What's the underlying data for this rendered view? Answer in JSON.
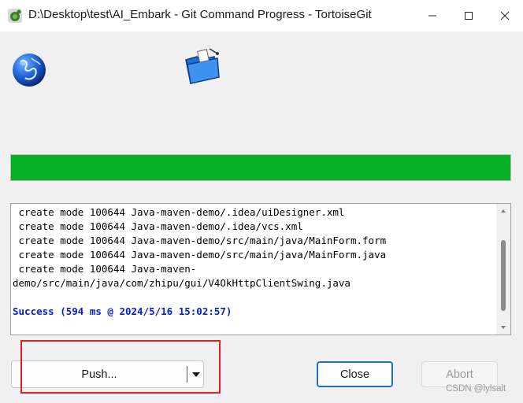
{
  "window": {
    "title": "D:\\Desktop\\test\\AI_Embark - Git Command Progress - TortoiseGit",
    "app_icon": "tortoisegit-icon"
  },
  "progress": {
    "fraction": 1.0,
    "color": "#06b025"
  },
  "log": {
    "lines": [
      {
        "text": " create mode 100644 Java-maven-demo/.idea/uiDesigner.xml",
        "kind": "normal"
      },
      {
        "text": " create mode 100644 Java-maven-demo/.idea/vcs.xml",
        "kind": "normal"
      },
      {
        "text": " create mode 100644 Java-maven-demo/src/main/java/MainForm.form",
        "kind": "normal"
      },
      {
        "text": " create mode 100644 Java-maven-demo/src/main/java/MainForm.java",
        "kind": "normal"
      },
      {
        "text": " create mode 100644 Java-maven-",
        "kind": "normal"
      },
      {
        "text": "demo/src/main/java/com/zhipu/gui/V4OkHttpClientSwing.java",
        "kind": "normal"
      },
      {
        "text": "",
        "kind": "blank"
      },
      {
        "text": "Success (594 ms @ 2024/5/16 15:02:57)",
        "kind": "success"
      }
    ],
    "success_color": "#0a20c8"
  },
  "buttons": {
    "push": "Push...",
    "close": "Close",
    "abort": "Abort"
  },
  "annotation": {
    "highlight_color": "#e02020"
  },
  "watermark": "CSDN @lylsalt"
}
